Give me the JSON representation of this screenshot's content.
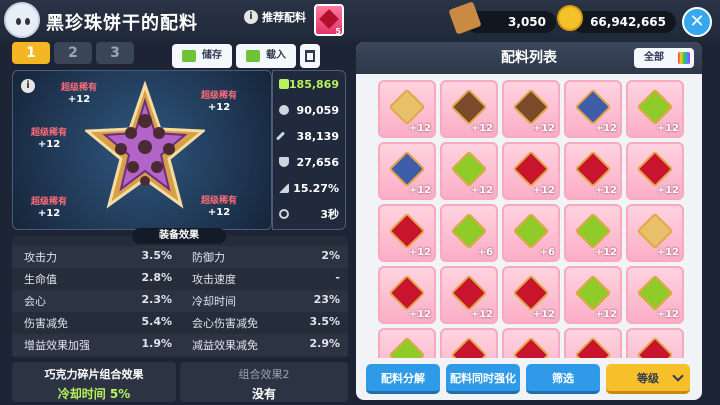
{
  "header": {
    "title": "黑珍珠饼干的配料",
    "recommend_label": "推荐配料",
    "recommend_count": "5",
    "currency1": "3,050",
    "currency2": "66,942,665"
  },
  "tabs": [
    "1",
    "2",
    "3"
  ],
  "slot_actions": {
    "save": "储存",
    "load": "载入"
  },
  "rarity_labels": [
    {
      "label": "超级稀有",
      "plus": "+12"
    },
    {
      "label": "超级稀有",
      "plus": "+12"
    },
    {
      "label": "超级稀有",
      "plus": "+12"
    },
    {
      "label": "超级稀有",
      "plus": "+12"
    },
    {
      "label": "超级稀有",
      "plus": "+12"
    }
  ],
  "stats": [
    {
      "icon": "power-icon",
      "value": "185,869"
    },
    {
      "icon": "heart-icon",
      "value": "90,059"
    },
    {
      "icon": "sword-icon",
      "value": "38,139"
    },
    {
      "icon": "shield-icon",
      "value": "27,656"
    },
    {
      "icon": "crit-icon",
      "value": "15.27%"
    },
    {
      "icon": "timer-icon",
      "value": "3秒"
    }
  ],
  "effects": {
    "title": "装备效果",
    "rows": [
      [
        {
          "k": "攻击力",
          "v": "3.5%"
        },
        {
          "k": "防御力",
          "v": "2%"
        }
      ],
      [
        {
          "k": "生命值",
          "v": "2.8%"
        },
        {
          "k": "攻击速度",
          "v": "-"
        }
      ],
      [
        {
          "k": "会心",
          "v": "2.3%"
        },
        {
          "k": "冷却时间",
          "v": "23%"
        }
      ],
      [
        {
          "k": "伤害减免",
          "v": "5.4%"
        },
        {
          "k": "会心伤害减免",
          "v": "3.5%"
        }
      ],
      [
        {
          "k": "增益效果加强",
          "v": "1.9%"
        },
        {
          "k": "减益效果减免",
          "v": "2.9%"
        }
      ]
    ]
  },
  "combo1": {
    "title": "巧克力碎片组合效果",
    "value": "冷却时间 5%"
  },
  "combo2": {
    "title": "组合效果2",
    "value": "没有"
  },
  "list": {
    "title": "配料列表",
    "filter": "全部",
    "cards": [
      {
        "gem": "cream",
        "lv": "+12"
      },
      {
        "gem": "choco",
        "lv": "+12"
      },
      {
        "gem": "choco",
        "lv": "+12"
      },
      {
        "gem": "blue",
        "lv": "+12"
      },
      {
        "gem": "lime",
        "lv": "+12"
      },
      {
        "gem": "blue",
        "lv": "+12"
      },
      {
        "gem": "lime",
        "lv": "+12"
      },
      {
        "gem": "berry",
        "lv": "+12"
      },
      {
        "gem": "berry",
        "lv": "+12"
      },
      {
        "gem": "berry",
        "lv": "+12"
      },
      {
        "gem": "berry",
        "lv": "+12"
      },
      {
        "gem": "lime",
        "lv": "+6"
      },
      {
        "gem": "lime",
        "lv": "+6"
      },
      {
        "gem": "lime",
        "lv": "+12"
      },
      {
        "gem": "cream",
        "lv": "+12"
      },
      {
        "gem": "berry",
        "lv": "+12"
      },
      {
        "gem": "berry",
        "lv": "+12"
      },
      {
        "gem": "berry",
        "lv": "+12"
      },
      {
        "gem": "lime",
        "lv": "+12"
      },
      {
        "gem": "lime",
        "lv": "+12"
      },
      {
        "gem": "lime",
        "lv": ""
      },
      {
        "gem": "berry",
        "lv": ""
      },
      {
        "gem": "berry",
        "lv": ""
      },
      {
        "gem": "berry",
        "lv": ""
      },
      {
        "gem": "berry",
        "lv": ""
      }
    ]
  },
  "buttons": {
    "dismantle": "配料分解",
    "enhance": "配料同时强化",
    "filter": "筛选",
    "sort": "等级"
  }
}
